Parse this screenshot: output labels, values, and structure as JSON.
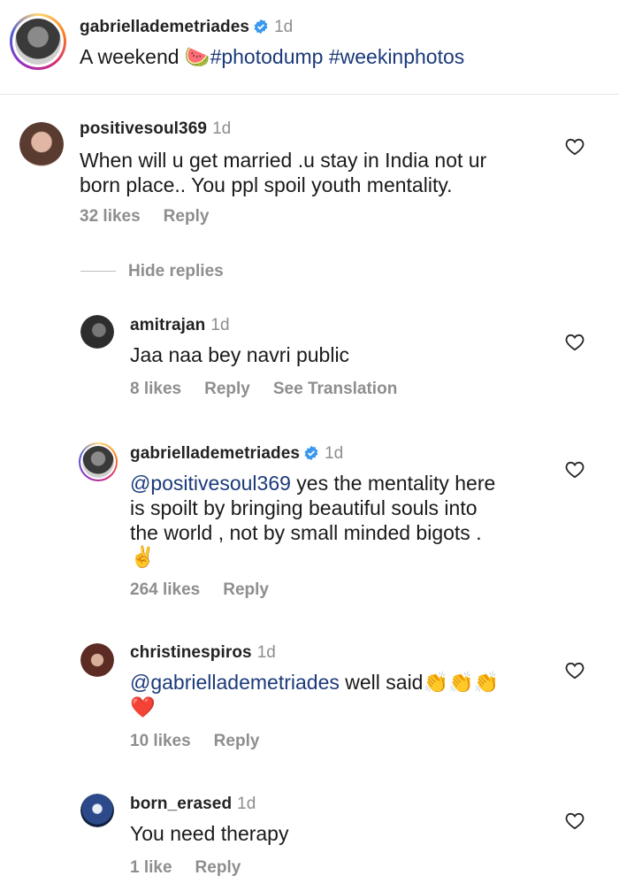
{
  "post": {
    "username": "gabriellademetriades",
    "time": "1d",
    "caption_prefix": "A weekend",
    "caption_emoji": "🍉",
    "hashtags": "#photodump #weekinphotos"
  },
  "comments": [
    {
      "username": "positivesoul369",
      "time": "1d",
      "text_lines": [
        "When will u get married .u stay in India not ur",
        "born place.. You ppl spoil youth mentality."
      ],
      "likes": "32 likes",
      "reply": "Reply"
    }
  ],
  "hide_replies": "Hide replies",
  "replies": [
    {
      "username": "amitrajan",
      "time": "1d",
      "text": "Jaa naa bey navri public",
      "likes": "8 likes",
      "reply": "Reply",
      "translate": "See Translation"
    },
    {
      "username": "gabriellademetriades",
      "time": "1d",
      "mention": "@positivesoul369",
      "text_first": " yes the mentality here",
      "text_lines": [
        "is spoilt by bringing beautiful souls into",
        "the world , not by small minded bigots ."
      ],
      "emoji": "✌️",
      "likes": "264 likes",
      "reply": "Reply"
    },
    {
      "username": "christinespiros",
      "time": "1d",
      "mention": "@gabriellademetriades",
      "text": " well said",
      "emoji_clap": "👏👏👏",
      "emoji_heart": "❤️",
      "likes": "10 likes",
      "reply": "Reply"
    },
    {
      "username": "born_erased",
      "time": "1d",
      "text": "You need therapy",
      "likes": "1 like",
      "reply": "Reply"
    }
  ],
  "colors": {
    "verified": "#3897f0",
    "mention": "#1b3a7a",
    "muted": "#8e8e8e"
  }
}
